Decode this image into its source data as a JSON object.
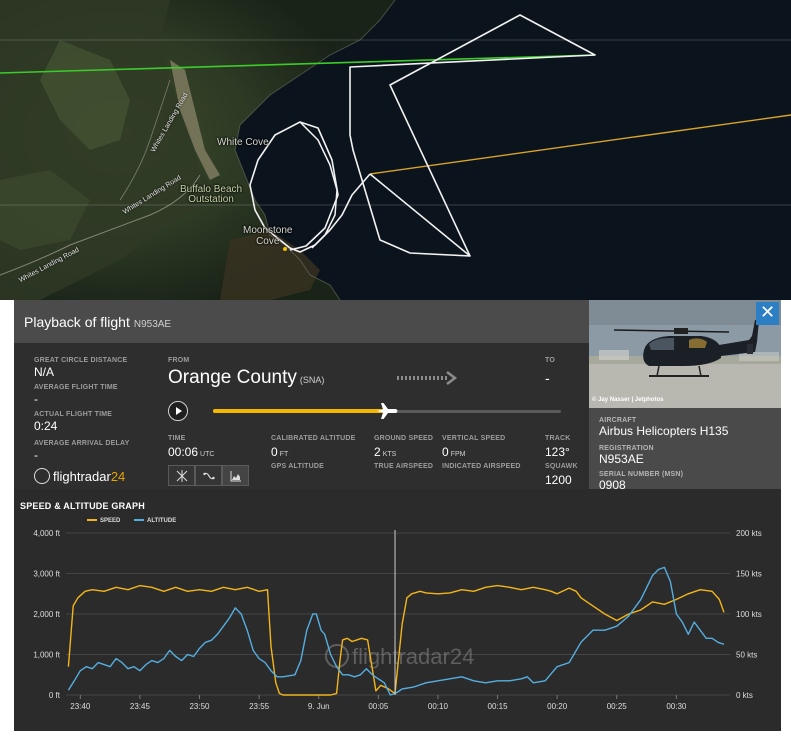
{
  "map": {
    "labels": {
      "white_cove": "White Cove",
      "buffalo_beach": "Buffalo Beach\nOutstation",
      "moonstone_cove": "Moonstone\nCove",
      "road_1": "Whites Landing Road",
      "road_2": "Whites Landing Road",
      "road_3": "Whites Landing Road"
    }
  },
  "header": {
    "title": "Playback of flight",
    "registration": "N953AE",
    "close_symbol": "✕"
  },
  "stats": {
    "great_circle_label": "GREAT CIRCLE DISTANCE",
    "great_circle_value": "N/A",
    "avg_flight_time_label": "AVERAGE FLIGHT TIME",
    "avg_flight_time_value": "-",
    "actual_flight_time_label": "ACTUAL FLIGHT TIME",
    "actual_flight_time_value": "0:24",
    "avg_arrival_delay_label": "AVERAGE ARRIVAL DELAY",
    "avg_arrival_delay_value": "-"
  },
  "route": {
    "from_label": "FROM",
    "from_city": "Orange County",
    "from_code": "(SNA)",
    "to_label": "TO",
    "to_value": "-"
  },
  "playback": {
    "progress_fraction": 0.5
  },
  "telemetry": {
    "time_label": "TIME",
    "time_value": "00:06",
    "time_unit": "UTC",
    "cal_alt_label": "CALIBRATED ALTITUDE",
    "cal_alt_value": "0",
    "cal_alt_unit": "FT",
    "gps_alt_label": "GPS ALTITUDE",
    "ground_speed_label": "GROUND SPEED",
    "ground_speed_value": "2",
    "ground_speed_unit": "KTS",
    "true_airspeed_label": "TRUE AIRSPEED",
    "vertical_speed_label": "VERTICAL SPEED",
    "vertical_speed_value": "0",
    "vertical_speed_unit": "FPM",
    "indicated_airspeed_label": "INDICATED AIRSPEED",
    "track_label": "TRACK",
    "track_value": "123°",
    "squawk_label": "SQUAWK",
    "squawk_value": "1200"
  },
  "aircraft": {
    "photo_credit": "© Jay Nasser | Jetphotos",
    "aircraft_label": "AIRCRAFT",
    "aircraft_value": "Airbus Helicopters H135",
    "registration_label": "REGISTRATION",
    "registration_value": "N953AE",
    "serial_label": "SERIAL NUMBER (MSN)",
    "serial_value": "0908"
  },
  "brand": {
    "logo_text_1": "flightradar",
    "logo_text_2": "24"
  },
  "graph": {
    "title": "SPEED & ALTITUDE GRAPH",
    "legend_speed": "SPEED",
    "legend_altitude": "ALTITUDE",
    "speed_color": "#f2b51b",
    "altitude_color": "#55aee0",
    "watermark": "flightradar24"
  },
  "chart_data": {
    "type": "line",
    "title": "SPEED & ALTITUDE GRAPH",
    "x_ticks": [
      "23:40",
      "23:45",
      "23:50",
      "23:55",
      "9. Jun",
      "00:05",
      "00:10",
      "00:15",
      "00:20",
      "00:25",
      "00:30"
    ],
    "y_left_ticks": [
      "0 ft",
      "1,000 ft",
      "2,000 ft",
      "3,000 ft",
      "4,000 ft"
    ],
    "y_right_ticks": [
      "0 kts",
      "50 kts",
      "100 kts",
      "150 kts",
      "200 kts"
    ],
    "x_range_minutes": [
      -21.2,
      34.5
    ],
    "y_left_range": [
      0,
      4000
    ],
    "y_right_range": [
      0,
      200
    ],
    "cursor_minutes": 6.4,
    "series": [
      {
        "name": "SPEED",
        "axis": "right",
        "x": [
          -21,
          -20.6,
          -20.2,
          -19.6,
          -19,
          -18,
          -17,
          -16,
          -15,
          -14,
          -13,
          -12,
          -11,
          -10,
          -9,
          -8,
          -7,
          -6,
          -5,
          -4.3,
          -4,
          -3.6,
          -3.3,
          -3,
          -2.5,
          -2,
          -1,
          0,
          1,
          1.5,
          1.8,
          2,
          2.4,
          2.8,
          3.2,
          3.6,
          4.1,
          4.8,
          5.2,
          5.8,
          6.4,
          7,
          7.4,
          7.8,
          8.5,
          9,
          10,
          11,
          12,
          13,
          14,
          15,
          16,
          17,
          18,
          19,
          19.5,
          20,
          21,
          21.6,
          22,
          23,
          24,
          25,
          26,
          27,
          28,
          29,
          30,
          31,
          32,
          33,
          33.6,
          34
        ],
        "values": [
          35,
          110,
          120,
          128,
          130,
          128,
          133,
          130,
          135,
          133,
          128,
          133,
          128,
          130,
          128,
          133,
          130,
          133,
          128,
          130,
          60,
          15,
          2,
          0,
          0,
          0,
          0,
          0,
          0,
          2,
          45,
          68,
          70,
          66,
          68,
          70,
          68,
          5,
          12,
          8,
          2,
          88,
          120,
          125,
          128,
          126,
          125,
          126,
          130,
          128,
          133,
          135,
          133,
          130,
          133,
          130,
          128,
          125,
          132,
          128,
          120,
          110,
          100,
          92,
          100,
          105,
          115,
          112,
          118,
          125,
          130,
          128,
          118,
          102
        ]
      },
      {
        "name": "ALTITUDE",
        "axis": "left",
        "x": [
          -21,
          -20.5,
          -20,
          -19.5,
          -19,
          -18.5,
          -18,
          -17.5,
          -17,
          -16.5,
          -16,
          -15.5,
          -15,
          -14.5,
          -14,
          -13.5,
          -13,
          -12.5,
          -12,
          -11.5,
          -11,
          -10.5,
          -10,
          -9.5,
          -9,
          -8.5,
          -8,
          -7.5,
          -7,
          -6.5,
          -6,
          -5.5,
          -5,
          -4.5,
          -4,
          -3.5,
          -3,
          -2,
          -1.5,
          -1,
          -0.5,
          -0.2,
          0.2,
          0.5,
          1,
          1.5,
          2,
          2.5,
          3,
          3.5,
          4,
          4.5,
          5,
          5.5,
          6,
          6.5,
          7,
          8,
          9,
          10,
          11,
          12,
          13,
          14,
          15,
          16,
          17,
          17.5,
          18,
          19,
          20,
          21,
          22,
          23,
          24,
          25,
          26,
          27,
          27.5,
          28,
          28.5,
          29,
          29.5,
          30,
          30.5,
          31,
          31.5,
          32,
          32.5,
          33,
          33.5,
          34
        ],
        "values": [
          120,
          350,
          600,
          700,
          650,
          800,
          750,
          700,
          900,
          800,
          650,
          700,
          600,
          750,
          850,
          800,
          900,
          1100,
          950,
          850,
          1000,
          950,
          1150,
          1300,
          1350,
          1500,
          1700,
          1900,
          2150,
          2000,
          1600,
          1100,
          900,
          800,
          600,
          450,
          450,
          500,
          850,
          1600,
          2000,
          2000,
          1600,
          1500,
          1000,
          700,
          500,
          500,
          450,
          500,
          650,
          500,
          400,
          300,
          0,
          50,
          150,
          200,
          300,
          350,
          400,
          450,
          350,
          300,
          350,
          350,
          400,
          450,
          300,
          350,
          700,
          800,
          1300,
          1600,
          1600,
          1700,
          1950,
          2350,
          2650,
          2950,
          3100,
          3150,
          2800,
          2000,
          1800,
          1500,
          1800,
          1600,
          1400,
          1400,
          1300,
          1250
        ]
      }
    ]
  }
}
